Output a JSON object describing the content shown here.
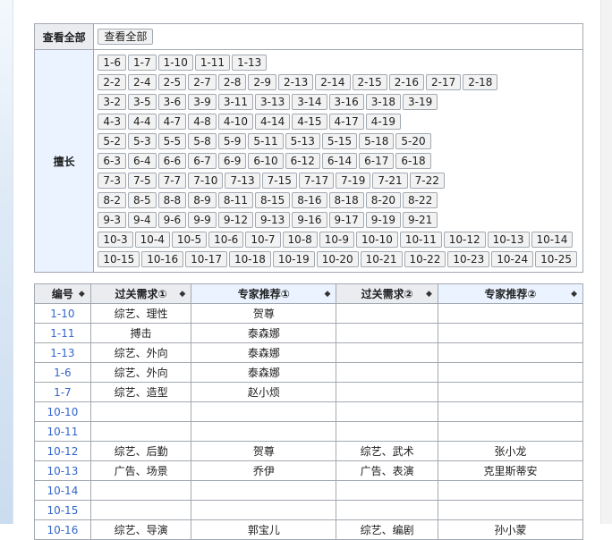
{
  "filter": {
    "show_all_label": "查看全部",
    "show_all_button": "查看全部",
    "expertise_label": "擅长",
    "button_rows": [
      [
        "1-6",
        "1-7",
        "1-10",
        "1-11",
        "1-13"
      ],
      [
        "2-2",
        "2-4",
        "2-5",
        "2-7",
        "2-8",
        "2-9",
        "2-13",
        "2-14",
        "2-15",
        "2-16",
        "2-17",
        "2-18"
      ],
      [
        "3-2",
        "3-5",
        "3-6",
        "3-9",
        "3-11",
        "3-13",
        "3-14",
        "3-16",
        "3-18",
        "3-19"
      ],
      [
        "4-3",
        "4-4",
        "4-7",
        "4-8",
        "4-10",
        "4-14",
        "4-15",
        "4-17",
        "4-19"
      ],
      [
        "5-2",
        "5-3",
        "5-5",
        "5-8",
        "5-9",
        "5-11",
        "5-13",
        "5-15",
        "5-18",
        "5-20"
      ],
      [
        "6-3",
        "6-4",
        "6-6",
        "6-7",
        "6-9",
        "6-10",
        "6-12",
        "6-14",
        "6-17",
        "6-18"
      ],
      [
        "7-3",
        "7-5",
        "7-7",
        "7-10",
        "7-13",
        "7-15",
        "7-17",
        "7-19",
        "7-21",
        "7-22"
      ],
      [
        "8-2",
        "8-5",
        "8-8",
        "8-9",
        "8-11",
        "8-15",
        "8-16",
        "8-18",
        "8-20",
        "8-22"
      ],
      [
        "9-3",
        "9-4",
        "9-6",
        "9-9",
        "9-12",
        "9-13",
        "9-16",
        "9-17",
        "9-19",
        "9-21"
      ],
      [
        "10-3",
        "10-4",
        "10-5",
        "10-6",
        "10-7",
        "10-8",
        "10-9",
        "10-10",
        "10-11",
        "10-12",
        "10-13",
        "10-14"
      ],
      [
        "10-15",
        "10-16",
        "10-17",
        "10-18",
        "10-19",
        "10-20",
        "10-21",
        "10-22",
        "10-23",
        "10-24",
        "10-25"
      ]
    ]
  },
  "table": {
    "headers": [
      "编号",
      "过关需求①",
      "专家推荐①",
      "过关需求②",
      "专家推荐②"
    ],
    "rows": [
      [
        "1-10",
        "综艺、理性",
        "贺尊",
        "",
        ""
      ],
      [
        "1-11",
        "搏击",
        "泰森娜",
        "",
        ""
      ],
      [
        "1-13",
        "综艺、外向",
        "泰森娜",
        "",
        ""
      ],
      [
        "1-6",
        "综艺、外向",
        "泰森娜",
        "",
        ""
      ],
      [
        "1-7",
        "综艺、造型",
        "赵小烦",
        "",
        ""
      ],
      [
        "10-10",
        "",
        "",
        "",
        ""
      ],
      [
        "10-11",
        "",
        "",
        "",
        ""
      ],
      [
        "10-12",
        "综艺、后勤",
        "贺尊",
        "综艺、武术",
        "张小龙"
      ],
      [
        "10-13",
        "广告、场景",
        "乔伊",
        "广告、表演",
        "克里斯蒂安"
      ],
      [
        "10-14",
        "",
        "",
        "",
        ""
      ],
      [
        "10-15",
        "",
        "",
        "",
        ""
      ],
      [
        "10-16",
        "综艺、导演",
        "郭宝儿",
        "综艺、编剧",
        "孙小蒙"
      ]
    ]
  },
  "colors": {
    "border": "#a2a9b1",
    "header_bg": "#eaecf0",
    "header_blue_bg": "#eaf3ff",
    "link": "#3366cc"
  },
  "icons": {
    "sort": "sort-icon"
  }
}
